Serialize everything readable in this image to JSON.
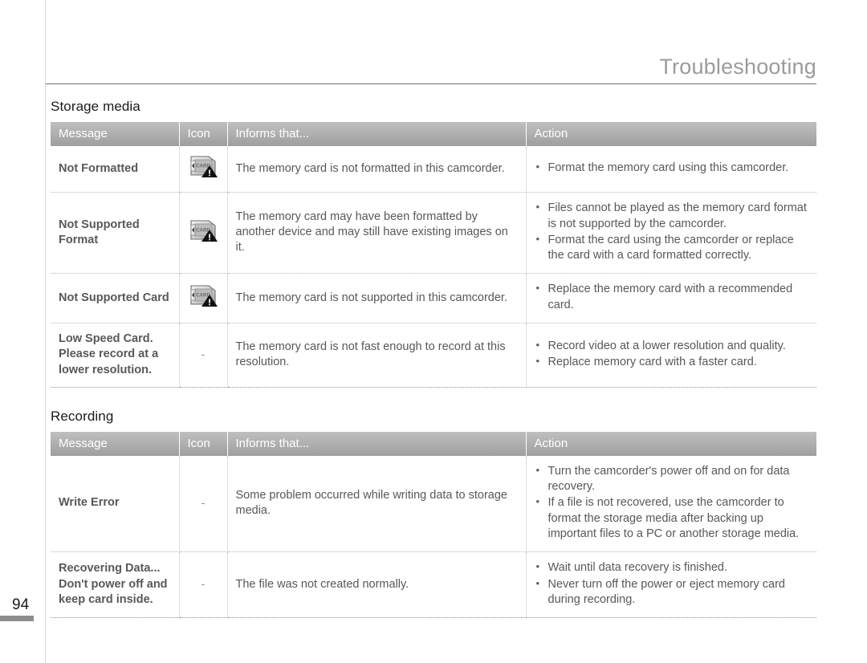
{
  "running_head": "Troubleshooting",
  "page_number": "94",
  "columns": {
    "message": "Message",
    "icon": "Icon",
    "informs": "Informs that...",
    "action": "Action"
  },
  "icons": {
    "card_warning": "memory-card-warning-icon",
    "none": "-"
  },
  "sections": [
    {
      "title": "Storage media",
      "rows": [
        {
          "message": "Not Formatted",
          "icon": "card-warning",
          "informs": "The memory card is not formatted in this camcorder.",
          "actions": [
            "Format the memory card using this camcorder."
          ]
        },
        {
          "message": "Not Supported Format",
          "icon": "card-warning",
          "informs": "The memory card may have been formatted by another device and may still have existing images on it.",
          "actions": [
            "Files cannot be played as the memory card format is not supported by the camcorder.",
            "Format the card using the camcorder or replace the card with a card formatted correctly."
          ]
        },
        {
          "message": "Not Supported Card",
          "icon": "card-warning",
          "informs": "The memory card is not supported in this camcorder.",
          "actions": [
            "Replace the memory card with a recommended card."
          ]
        },
        {
          "message": "Low Speed Card. Please record at a lower resolution.",
          "icon": "none",
          "informs": "The memory card is not fast enough to record at this resolution.",
          "actions": [
            "Record video at a lower resolution and quality.",
            "Replace memory card with a faster card."
          ]
        }
      ]
    },
    {
      "title": "Recording",
      "rows": [
        {
          "message": "Write Error",
          "icon": "none",
          "informs": "Some problem occurred while writing data to storage media.",
          "actions": [
            "Turn the camcorder's power off and on for data recovery.",
            "If a file is not recovered, use the camcorder to format the storage media after backing up important files to a PC or another storage media."
          ]
        },
        {
          "message": "Recovering Data... Don't power off and keep card inside.",
          "icon": "none",
          "informs": "The file was not created normally.",
          "actions": [
            "Wait until data recovery is finished.",
            "Never turn off the power or eject memory card during recording."
          ]
        }
      ]
    }
  ]
}
